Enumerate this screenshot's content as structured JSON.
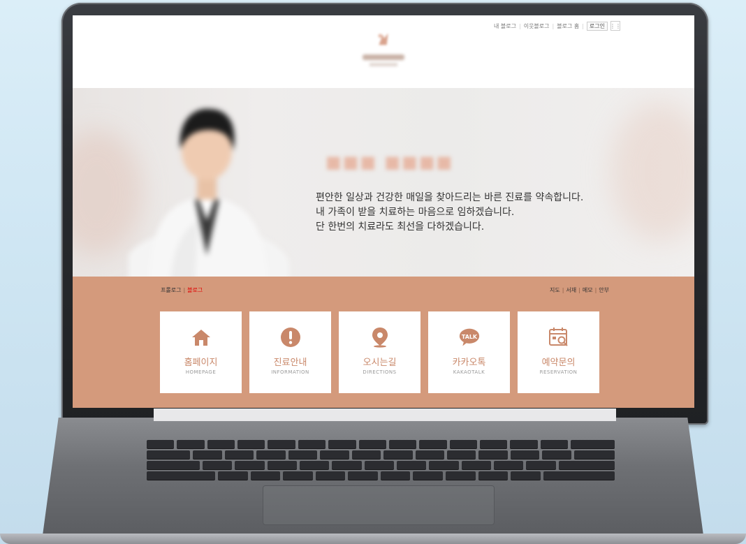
{
  "topbar": {
    "my_blog": "내 블로그",
    "neighbor_blog": "이웃블로그",
    "blog_home": "블로그 홈",
    "login": "로그인"
  },
  "hero": {
    "lines": [
      "편안한 일상과 건강한 매일을 찾아드리는 바른 진료를 약속합니다.",
      "내 가족이 받을 치료하는 마음으로 임하겠습니다.",
      "단 한번의 치료라도 최선을 다하겠습니다."
    ]
  },
  "nav": {
    "left": [
      "프롤로그",
      "블로그"
    ],
    "right": [
      "지도",
      "서재",
      "메모",
      "안부"
    ]
  },
  "cards": [
    {
      "label": "홈페이지",
      "sub": "HOMEPAGE",
      "icon": "home-icon"
    },
    {
      "label": "진료안내",
      "sub": "INFORMATION",
      "icon": "exclamation-icon"
    },
    {
      "label": "오시는길",
      "sub": "DIRECTIONS",
      "icon": "location-pin-icon"
    },
    {
      "label": "카카오톡",
      "sub": "KAKAOTALK",
      "icon": "talk-bubble-icon"
    },
    {
      "label": "예약문의",
      "sub": "RESERVATION",
      "icon": "calendar-search-icon"
    }
  ],
  "colors": {
    "accent": "#d49a7c",
    "icon": "#c9886a",
    "nav_active": "#e10000"
  }
}
